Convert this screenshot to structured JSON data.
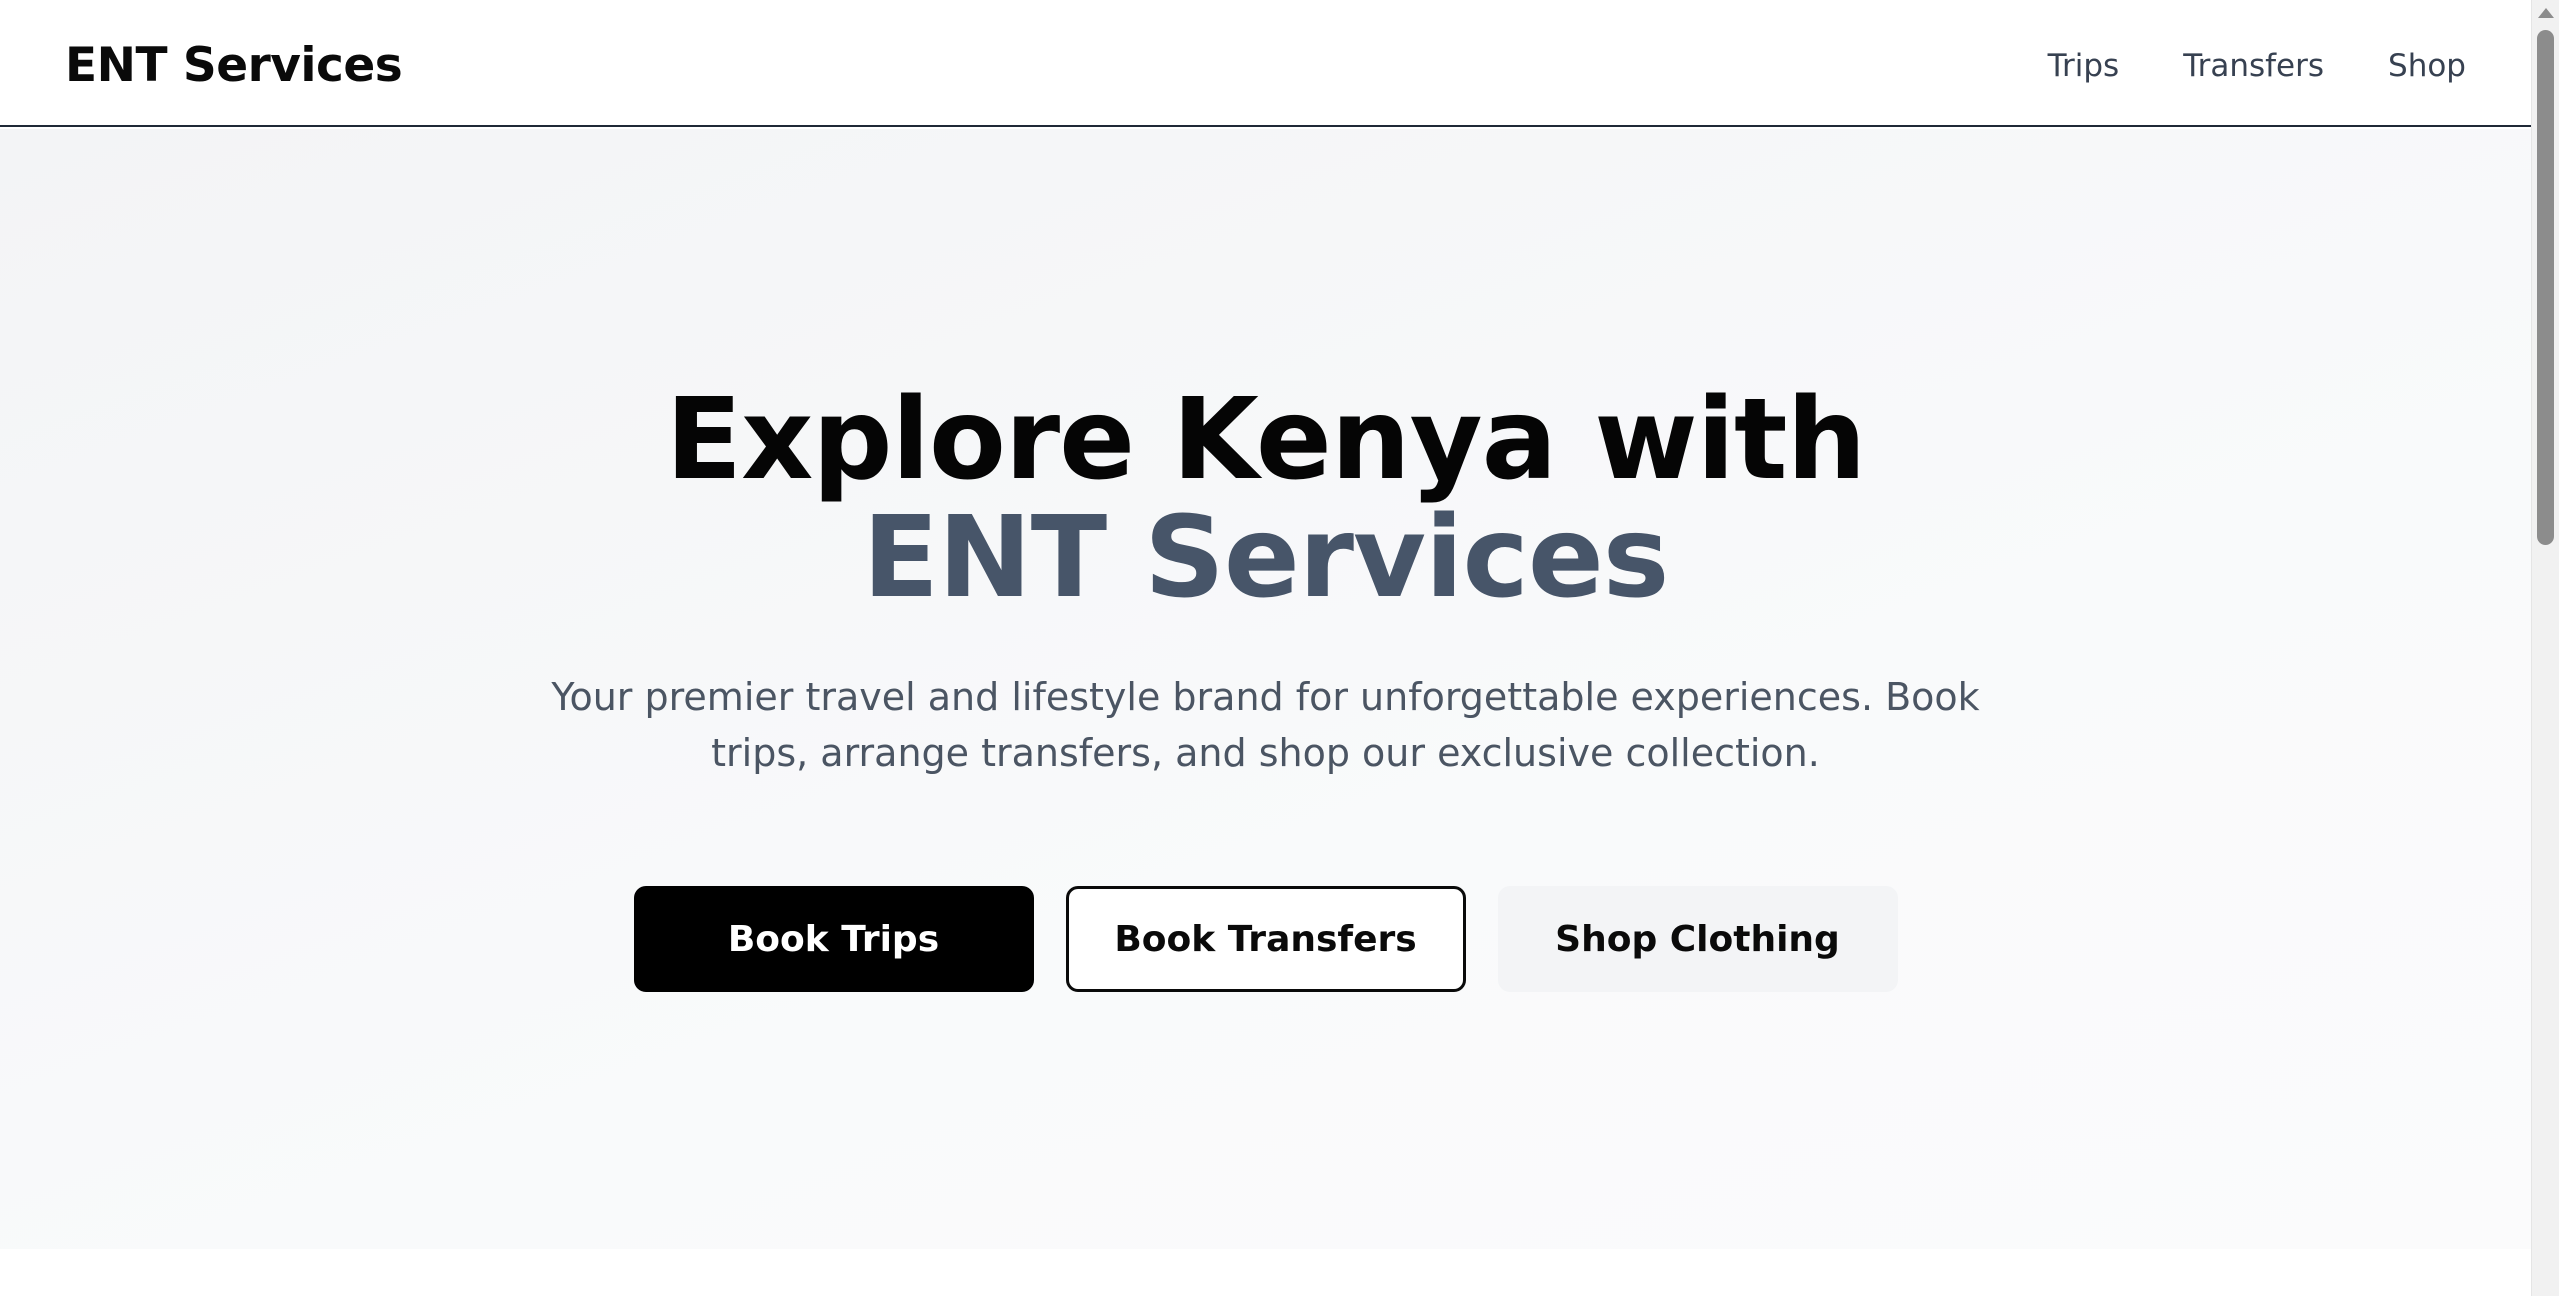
{
  "header": {
    "logo": "ENT Services",
    "nav": [
      {
        "label": "Trips"
      },
      {
        "label": "Transfers"
      },
      {
        "label": "Shop"
      }
    ]
  },
  "hero": {
    "title_line1": "Explore Kenya with",
    "title_line2": "ENT Services",
    "subtitle": "Your premier travel and lifestyle brand for unforgettable experiences. Book trips, arrange transfers, and shop our exclusive collection.",
    "buttons": {
      "book_trips": "Book Trips",
      "book_transfers": "Book Transfers",
      "shop_clothing": "Shop Clothing"
    }
  },
  "colors": {
    "accent_text": "#475569",
    "primary_button": "#000000",
    "ghost_button": "#f3f4f6"
  },
  "icons": {
    "scroll_up": "scroll-up-arrow-icon"
  }
}
